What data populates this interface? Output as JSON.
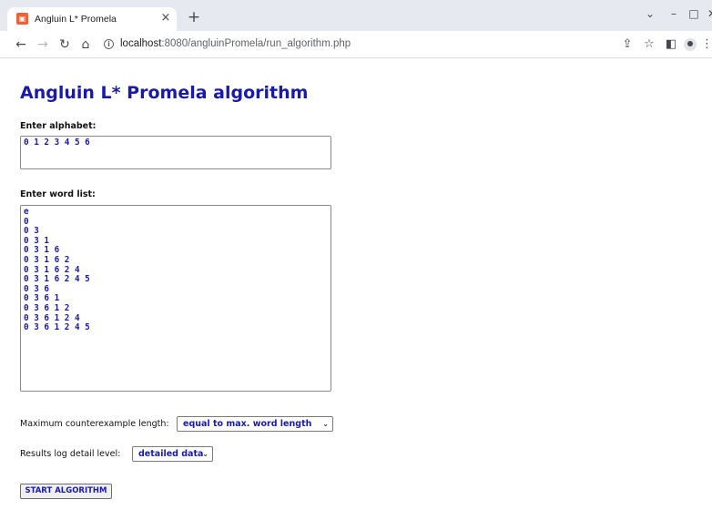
{
  "browser": {
    "tab_title": "Angluin L* Promela",
    "tab_close": "×",
    "new_tab": "+",
    "url_host": "localhost",
    "url_path": ":8080/angluinPromela/run_algorithm.php",
    "icons": [
      "back-icon",
      "forward-icon",
      "reload-icon",
      "home-icon",
      "info-icon",
      "share-icon",
      "star-icon",
      "sidepanel-icon",
      "profile-icon",
      "menu-icon"
    ],
    "window_controls": [
      "chevron-down-icon",
      "minimize-icon",
      "maximize-icon",
      "close-icon"
    ]
  },
  "page": {
    "title": "Angluin L* Promela algorithm",
    "alphabet_label": "Enter alphabet:",
    "alphabet_value": "0 1 2 3 4 5 6",
    "wordlist_label": "Enter word list:",
    "wordlist_value": "e\n0\n0 3\n0 3 1\n0 3 1 6\n0 3 1 6 2\n0 3 1 6 2 4\n0 3 1 6 2 4 5\n0 3 6\n0 3 6 1\n0 3 6 1 2\n0 3 6 1 2 4\n0 3 6 1 2 4 5",
    "max_cex_label": "Maximum counterexample length:",
    "max_cex_selected": "equal to max. word length",
    "detail_label": "Results log detail level:",
    "detail_selected": "detailed data",
    "start_button": "START ALGORITHM"
  },
  "colors": {
    "heading": "#1a1aa8",
    "tabstrip": "#e6e9ef",
    "favicon": "#e8623a"
  }
}
